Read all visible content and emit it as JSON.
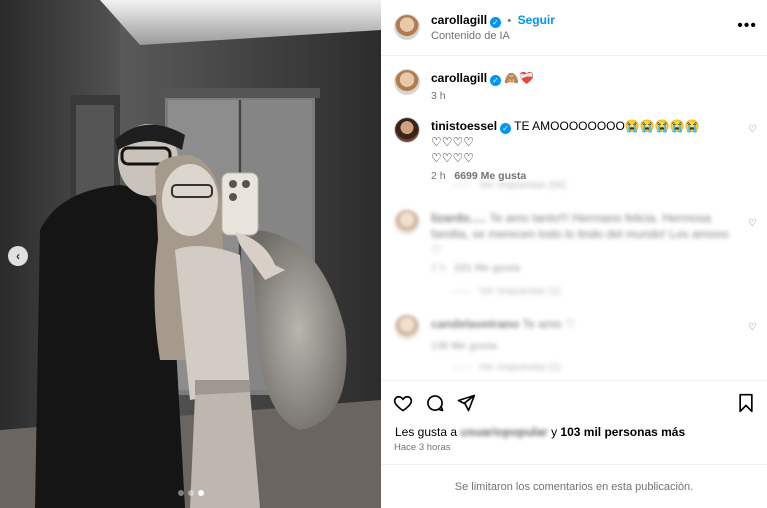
{
  "post": {
    "author": "carollagill",
    "follow_label": "Seguir",
    "ai_label": "Contenido de IA",
    "more_icon": "more-options-icon",
    "caption_emojis": "🙈❤️‍🩹",
    "caption_time": "3 h",
    "carousel_prev_label": "‹"
  },
  "comments": [
    {
      "user": "tinistoessel",
      "text_line1": "TE AMOOOOOOOO😭😭😭😭😭♡♡♡♡",
      "text_line2": "♡♡♡♡",
      "time": "2 h",
      "likes": "6699 Me gusta",
      "replies": "Ver respuestas (56)"
    },
    {
      "user": "lizardo.....",
      "text_line1": "Te amo tanto!!! Hermano felicia. Hermosa",
      "text_line2": "familia, se merecen todo lo lindo del mundo! Los amooo",
      "text_line3": "♡",
      "time": "2 h",
      "likes": "221 Me gusta",
      "replies": "Ver respuestas (1)"
    },
    {
      "user": "candelavetrano",
      "text_line1": "Te amo ♡",
      "likes": "130 Me gusta",
      "replies": "Ver respuestas (1)"
    }
  ],
  "footer": {
    "liked_by_prefix": "Les gusta a",
    "liked_by_user": "usuariopopular",
    "liked_by_suffix": "y",
    "liked_by_count": "103 mil personas más",
    "time_ago": "Hace 3 horas",
    "comments_limited": "Se limitaron los comentarios en esta publicación."
  },
  "colors": {
    "accent": "#0095f6",
    "muted": "#737373"
  }
}
